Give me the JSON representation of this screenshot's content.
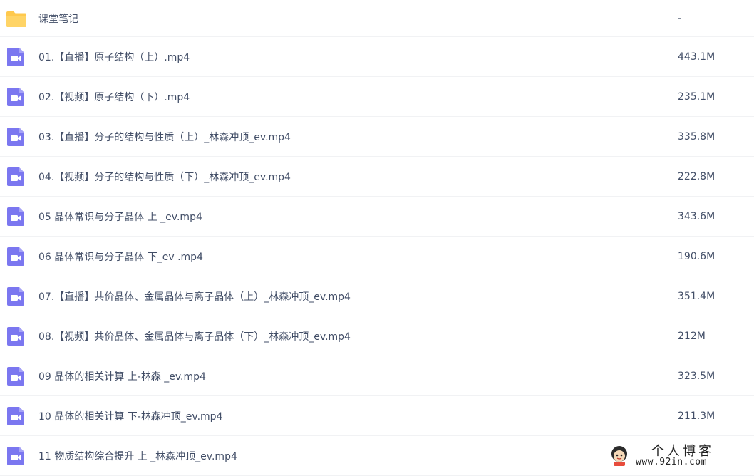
{
  "colors": {
    "folder": "#ffc94d",
    "video": "#7b77f0",
    "text": "#424e67",
    "divider": "#f1f2f4"
  },
  "files": [
    {
      "name": "课堂笔记",
      "size": "-",
      "type": "folder",
      "icon": "folder-icon"
    },
    {
      "name": "01.【直播】原子结构（上）.mp4",
      "size": "443.1M",
      "type": "video",
      "icon": "video-file-icon"
    },
    {
      "name": "02.【视频】原子结构（下）.mp4",
      "size": "235.1M",
      "type": "video",
      "icon": "video-file-icon"
    },
    {
      "name": "03.【直播】分子的结构与性质（上）_林森冲顶_ev.mp4",
      "size": "335.8M",
      "type": "video",
      "icon": "video-file-icon"
    },
    {
      "name": "04.【视频】分子的结构与性质（下）_林森冲顶_ev.mp4",
      "size": "222.8M",
      "type": "video",
      "icon": "video-file-icon"
    },
    {
      "name": "05 晶体常识与分子晶体 上 _ev.mp4",
      "size": "343.6M",
      "type": "video",
      "icon": "video-file-icon"
    },
    {
      "name": "06 晶体常识与分子晶体 下_ev .mp4",
      "size": "190.6M",
      "type": "video",
      "icon": "video-file-icon"
    },
    {
      "name": "07.【直播】共价晶体、金属晶体与离子晶体（上）_林森冲顶_ev.mp4",
      "size": "351.4M",
      "type": "video",
      "icon": "video-file-icon"
    },
    {
      "name": "08.【视频】共价晶体、金属晶体与离子晶体（下）_林森冲顶_ev.mp4",
      "size": "212M",
      "type": "video",
      "icon": "video-file-icon"
    },
    {
      "name": "09 晶体的相关计算 上-林森 _ev.mp4",
      "size": "323.5M",
      "type": "video",
      "icon": "video-file-icon"
    },
    {
      "name": "10 晶体的相关计算 下-林森冲顶_ev.mp4",
      "size": "211.3M",
      "type": "video",
      "icon": "video-file-icon"
    },
    {
      "name": "11 物质结构综合提升 上 _林森冲顶_ev.mp4",
      "size": "",
      "type": "video",
      "icon": "video-file-icon"
    }
  ],
  "watermark": {
    "title": "个人博客",
    "url": "www.92in.com",
    "logo_icon": "blog-logo-icon"
  }
}
